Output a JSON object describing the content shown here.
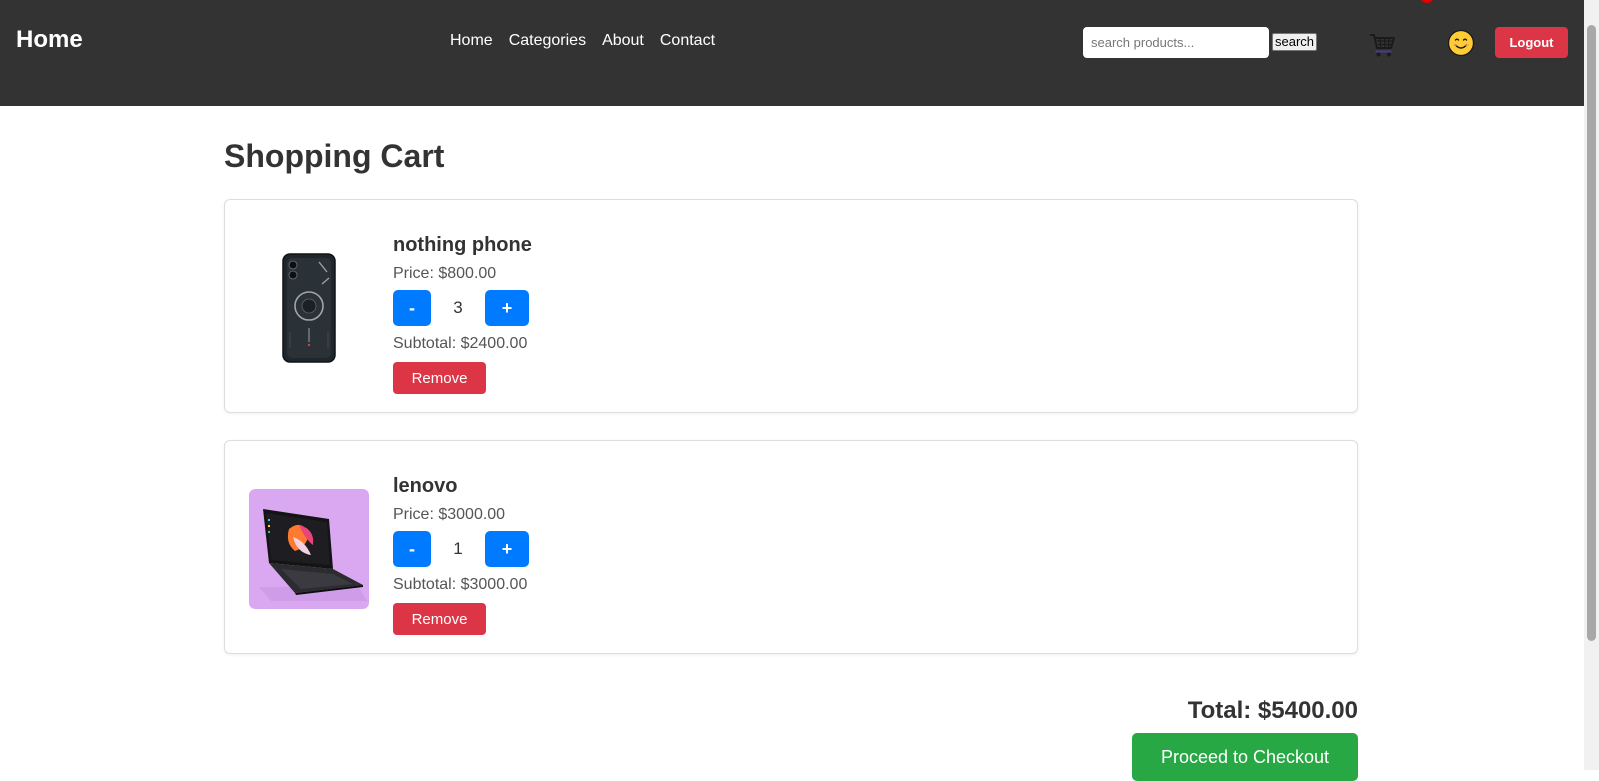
{
  "nav": {
    "brand": "Home",
    "links": [
      "Home",
      "Categories",
      "About",
      "Contact"
    ],
    "search_placeholder": "search products...",
    "search_button": "search",
    "cart_icon": "shopping-cart-icon",
    "user_icon": "smiley-face-icon",
    "logout": "Logout"
  },
  "cart": {
    "title": "Shopping Cart",
    "items": [
      {
        "name": "nothing phone",
        "price": "Price: $800.00",
        "minus": "-",
        "quantity": "3",
        "plus": "+",
        "subtotal": "Subtotal: $2400.00",
        "remove": "Remove"
      },
      {
        "name": "lenovo",
        "price": "Price: $3000.00",
        "minus": "-",
        "quantity": "1",
        "plus": "+",
        "subtotal": "Subtotal: $3000.00",
        "remove": "Remove"
      }
    ],
    "total": "Total: $5400.00",
    "checkout": "Proceed to Checkout"
  },
  "colors": {
    "navbar": "#333333",
    "primary": "#007bff",
    "danger": "#dc3545",
    "success": "#28a745",
    "laptop_bg": "#d9a8f0"
  }
}
